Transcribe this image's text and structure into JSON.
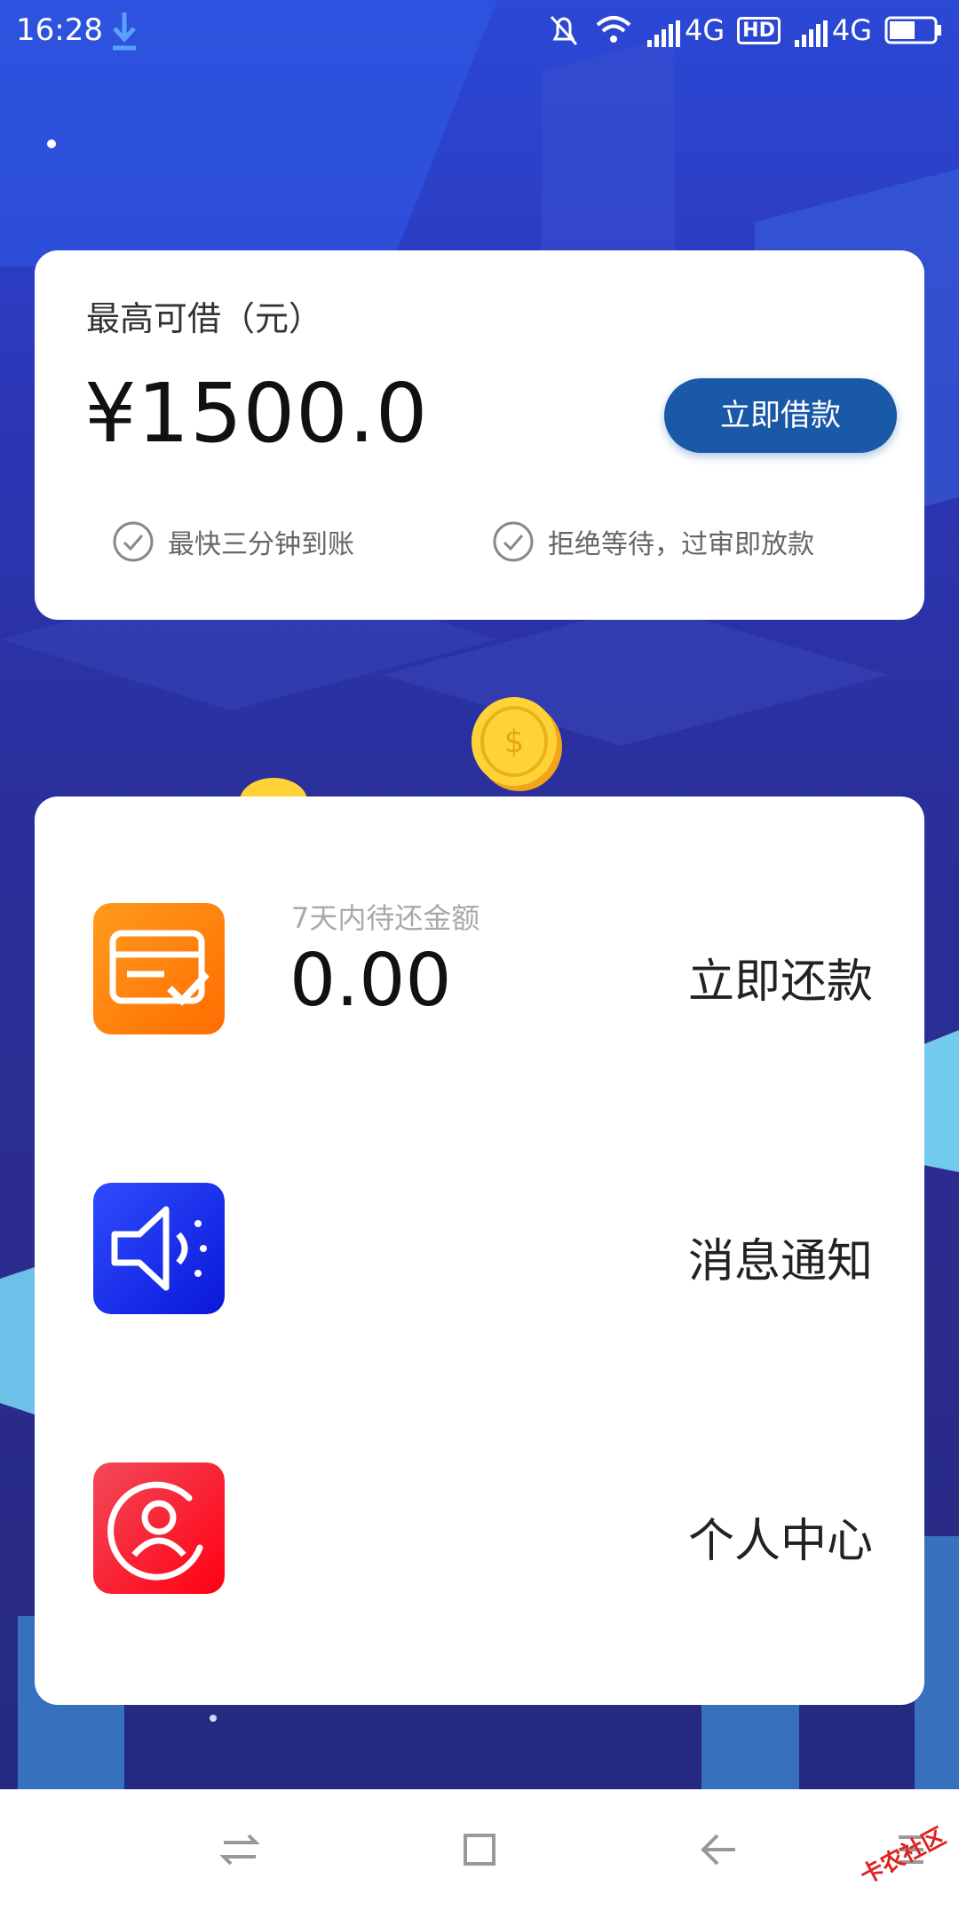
{
  "status_bar": {
    "time": "16:28",
    "network1": "4G",
    "hd": "HD",
    "network2": "4G"
  },
  "loan_card": {
    "label": "最高可借（元）",
    "amount": "¥1500.0",
    "button": "立即借款",
    "feature1": "最快三分钟到账",
    "feature2": "拒绝等待，过审即放款"
  },
  "menu": {
    "repay": {
      "sub_label": "7天内待还金额",
      "amount": "0.00",
      "action": "立即还款",
      "icon": "bill-icon",
      "color": "#ff7a00"
    },
    "notify": {
      "action": "消息通知",
      "icon": "speaker-icon",
      "color": "#1a2cf0"
    },
    "profile": {
      "action": "个人中心",
      "icon": "user-icon",
      "color": "#f0143c"
    }
  },
  "watermark": "卡农社区"
}
